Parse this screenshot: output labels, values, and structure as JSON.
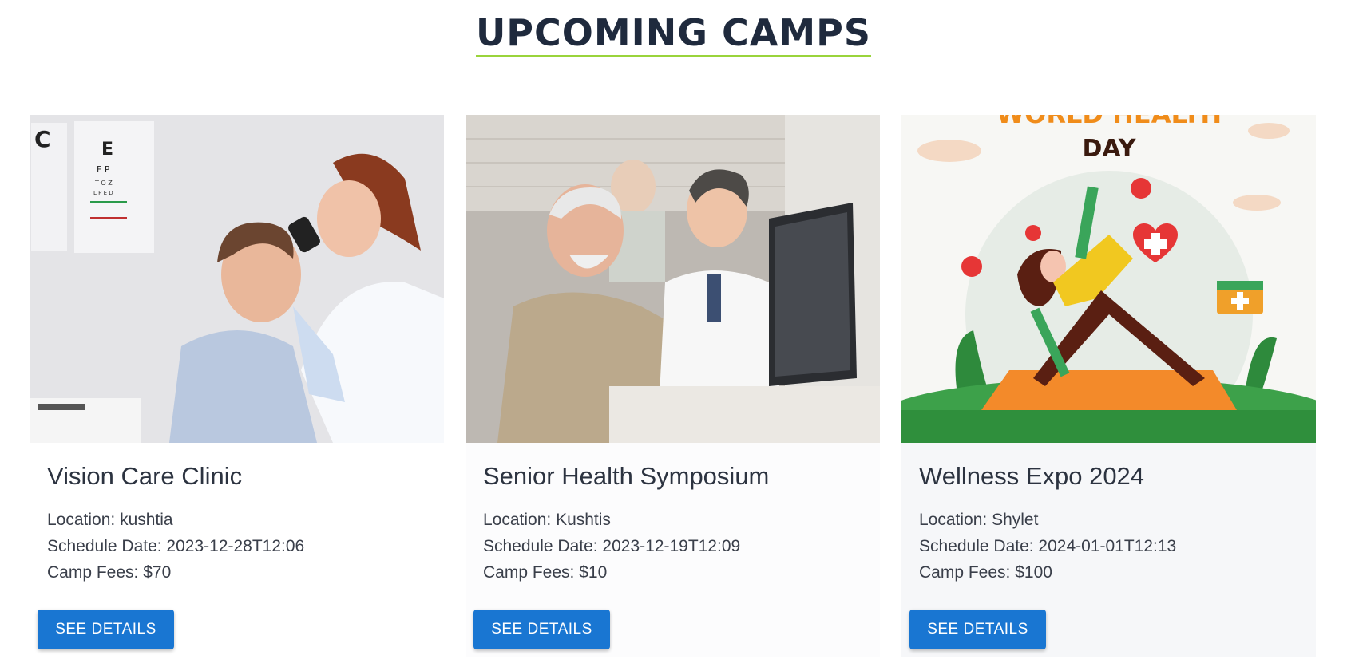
{
  "section": {
    "title": "UPCOMING CAMPS"
  },
  "colors": {
    "accent_underline": "#9ad43b",
    "button": "#1976d2",
    "title": "#1f2a3d"
  },
  "camps": [
    {
      "title": "Vision Care Clinic",
      "location": "Location: kushtia",
      "schedule": "Schedule Date: 2023-12-28T12:06",
      "fees": "Camp Fees: $70",
      "button_label": "SEE DETAILS",
      "image": "photo-eye-exam"
    },
    {
      "title": "Senior Health Symposium",
      "location": "Location: Kushtis",
      "schedule": "Schedule Date: 2023-12-19T12:09",
      "fees": "Camp Fees: $10",
      "button_label": "SEE DETAILS",
      "image": "photo-doctor-consultation"
    },
    {
      "title": "Wellness Expo 2024",
      "location": "Location: Shylet",
      "schedule": "Schedule Date: 2024-01-01T12:13",
      "fees": "Camp Fees: $100",
      "button_label": "SEE DETAILS",
      "image": "illustration-world-health-day",
      "image_text": [
        "WORLD HEALTH",
        "DAY"
      ]
    }
  ]
}
